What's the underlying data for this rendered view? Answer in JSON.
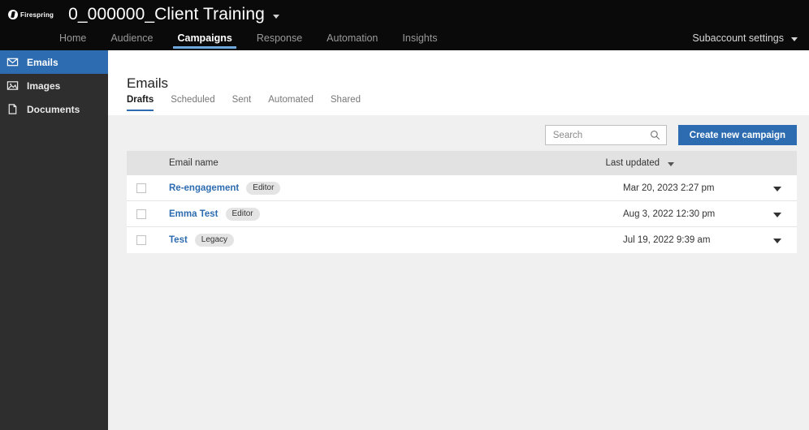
{
  "topbar": {
    "logo_name": "firespring-logo",
    "logo_text": "Firespring",
    "account_title": "0_000000_Client Training",
    "nav": [
      {
        "label": "Home",
        "active": false
      },
      {
        "label": "Audience",
        "active": false
      },
      {
        "label": "Campaigns",
        "active": true
      },
      {
        "label": "Response",
        "active": false
      },
      {
        "label": "Automation",
        "active": false
      },
      {
        "label": "Insights",
        "active": false
      }
    ],
    "subaccount_settings": "Subaccount settings"
  },
  "sidebar": {
    "items": [
      {
        "label": "Emails",
        "icon": "envelope-icon",
        "active": true
      },
      {
        "label": "Images",
        "icon": "image-icon",
        "active": false
      },
      {
        "label": "Documents",
        "icon": "document-icon",
        "active": false
      }
    ]
  },
  "main": {
    "page_title": "Emails",
    "tabs": [
      {
        "label": "Drafts",
        "active": true
      },
      {
        "label": "Scheduled",
        "active": false
      },
      {
        "label": "Sent",
        "active": false
      },
      {
        "label": "Automated",
        "active": false
      },
      {
        "label": "Shared",
        "active": false
      }
    ],
    "search": {
      "value": "",
      "placeholder": "Search"
    },
    "create_button": "Create new campaign",
    "table": {
      "columns": {
        "name": "Email name",
        "updated": "Last updated"
      },
      "rows": [
        {
          "name": "Re-engagement",
          "badge": "Editor",
          "updated": "Mar 20, 2023 2:27 pm"
        },
        {
          "name": "Emma Test",
          "badge": "Editor",
          "updated": "Aug 3, 2022 12:30 pm"
        },
        {
          "name": "Test",
          "badge": "Legacy",
          "updated": "Jul 19, 2022 9:39 am"
        }
      ]
    }
  },
  "colors": {
    "topbar_bg": "#0a0a0a",
    "sidebar_bg": "#2e2e2e",
    "accent_blue": "#2d6cb0",
    "nav_underline": "#6ea8dc",
    "page_bg": "#f0f0f0",
    "table_header_bg": "#e2e2e2",
    "badge_bg": "#e4e4e4"
  }
}
